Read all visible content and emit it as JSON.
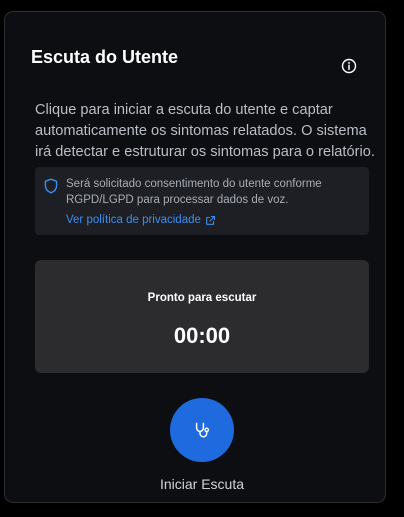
{
  "panel": {
    "title": "Escuta do Utente",
    "description": "Clique para iniciar a escuta do utente e captar automaticamente os sintomas relatados. O sistema irá detectar e estruturar os sintomas para o relatório."
  },
  "consent": {
    "text": "Será solicitado consentimento do utente conforme RGPD/LGPD para processar dados de voz.",
    "link_label": "Ver política de privacidade"
  },
  "status": {
    "label": "Pronto para escutar",
    "timer": "00:00"
  },
  "action": {
    "label": "Iniciar Escuta"
  },
  "icons": {
    "info": "info-icon",
    "shield": "shield-icon",
    "external_link": "external-link-icon",
    "stethoscope": "stethoscope-icon"
  },
  "colors": {
    "accent": "#1f6adf",
    "link": "#3b8ef0",
    "card_background": "#0d0e11",
    "status_panel": "#2c2c2e"
  }
}
